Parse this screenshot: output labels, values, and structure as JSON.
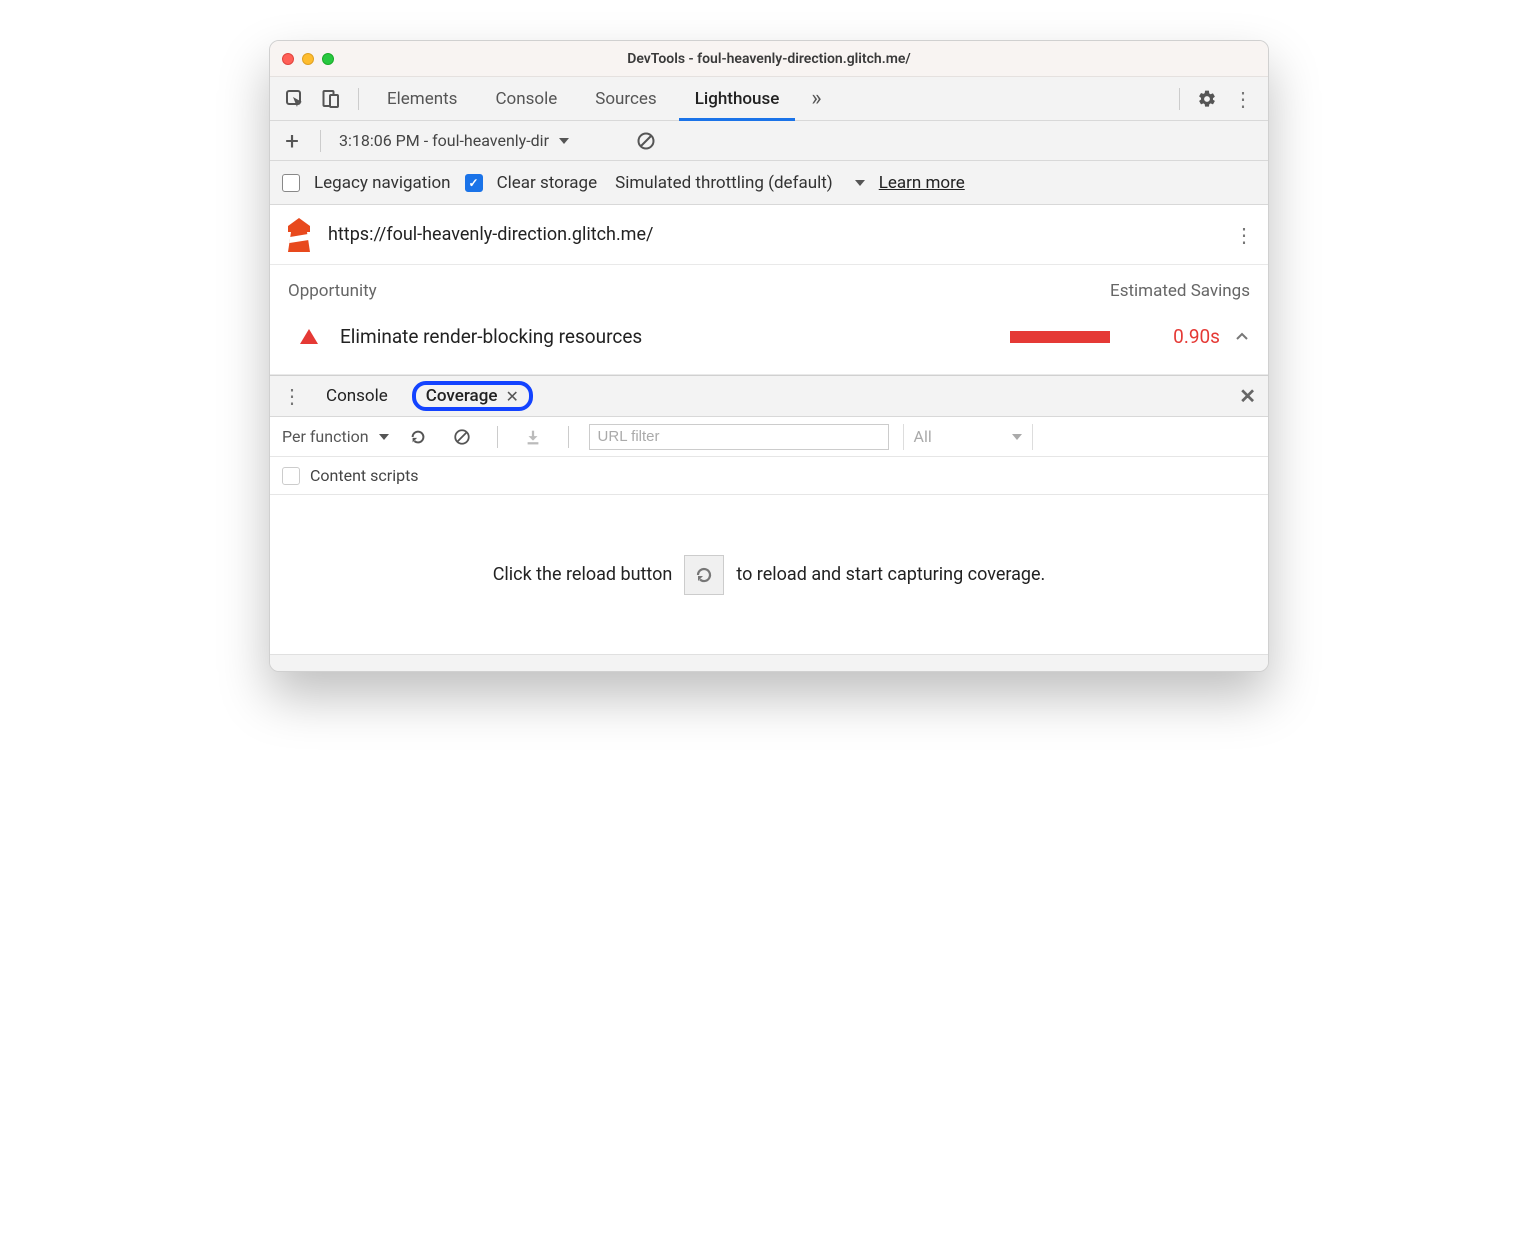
{
  "window": {
    "title": "DevTools - foul-heavenly-direction.glitch.me/"
  },
  "tabs": {
    "items": [
      "Elements",
      "Console",
      "Sources",
      "Lighthouse"
    ],
    "active": 3
  },
  "lighthouse": {
    "report_selector": "3:18:06 PM - foul-heavenly-dir",
    "legacy_nav_label": "Legacy navigation",
    "clear_storage_label": "Clear storage",
    "throttling_label": "Simulated throttling (default)",
    "learn_more": "Learn more",
    "url": "https://foul-heavenly-direction.glitch.me/",
    "col_opportunity": "Opportunity",
    "col_savings": "Estimated Savings",
    "opportunity": {
      "title": "Eliminate render-blocking resources",
      "savings": "0.90s",
      "color": "#e53935"
    }
  },
  "drawer": {
    "tabs": [
      "Console",
      "Coverage"
    ],
    "active": 1,
    "granularity": "Per function",
    "url_filter_placeholder": "URL filter",
    "type_filter": "All",
    "content_scripts_label": "Content scripts",
    "placeholder_pre": "Click the reload button",
    "placeholder_post": "to reload and start capturing coverage."
  }
}
